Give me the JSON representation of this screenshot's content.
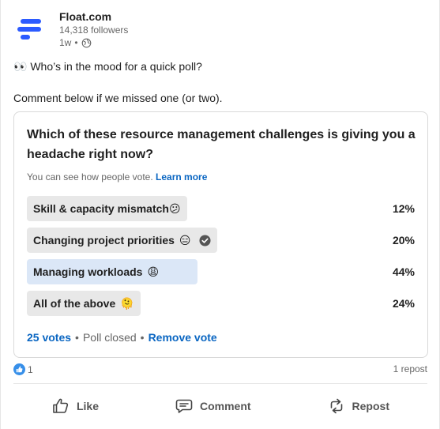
{
  "author": {
    "name": "Float.com",
    "followers": "14,318 followers",
    "posted": "1w",
    "separator": "•",
    "visibility_icon": "globe-icon",
    "logo_icon": "float-logo"
  },
  "post": {
    "line1": "👀 Who’s in the mood for a quick poll?",
    "line2": "Comment below if we missed one (or two)."
  },
  "poll": {
    "question": "Which of these resource management challenges is giving you a headache right now?",
    "note": "You can see how people vote.",
    "learn_more": "Learn more",
    "options": [
      {
        "label": "Skill & capacity mismatch",
        "emoji": "😕",
        "percent": "12%",
        "fraction": 0.12,
        "voted": false
      },
      {
        "label": "Changing project priorities",
        "emoji": "😑",
        "percent": "20%",
        "fraction": 0.2,
        "voted": true
      },
      {
        "label": "Managing workloads",
        "emoji": "😩",
        "percent": "44%",
        "fraction": 0.44,
        "voted": false
      },
      {
        "label": "All of the above",
        "emoji": "🫠",
        "percent": "24%",
        "fraction": 0.24,
        "voted": false
      }
    ],
    "votes": "25 votes",
    "dot": "•",
    "status": "Poll closed",
    "remove_vote": "Remove vote"
  },
  "social": {
    "reactions": "1",
    "reaction_icon": "like-icon",
    "reposts": "1 repost"
  },
  "actions": {
    "like": "Like",
    "comment": "Comment",
    "repost": "Repost"
  },
  "colors": {
    "brand_blue": "#0a66c2",
    "float_blue": "#2c5bff",
    "bar_grey": "#e8e8e8",
    "bar_highlight": "#dbe7f7"
  }
}
